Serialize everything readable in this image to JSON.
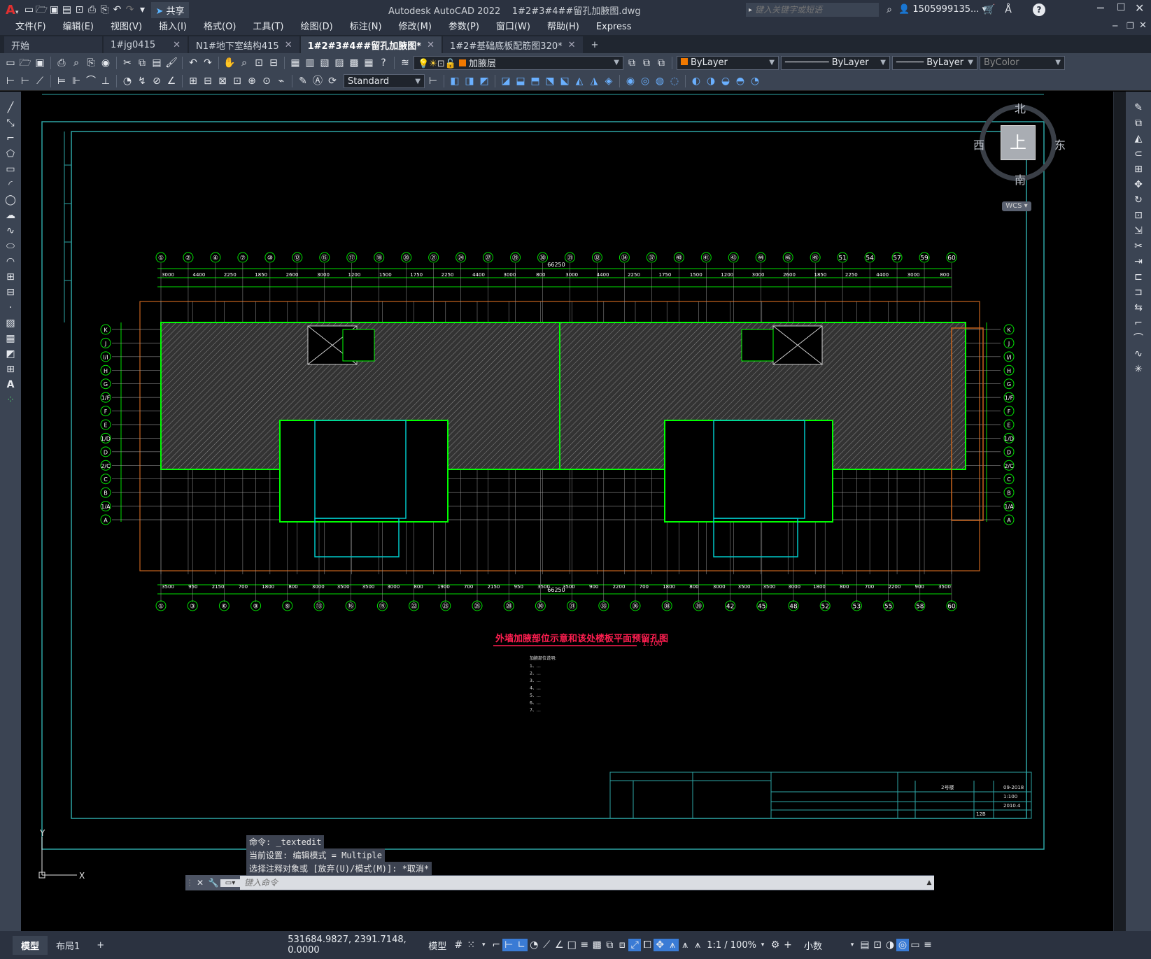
{
  "app": {
    "title": "Autodesk AutoCAD 2022",
    "file": "1#2#3#4##留孔加腋图.dwg",
    "share_label": "共享",
    "search_placeholder": "键入关键字或短语",
    "user": "1505999135...",
    "help": "?"
  },
  "menu": [
    "文件(F)",
    "编辑(E)",
    "视图(V)",
    "插入(I)",
    "格式(O)",
    "工具(T)",
    "绘图(D)",
    "标注(N)",
    "修改(M)",
    "参数(P)",
    "窗口(W)",
    "帮助(H)",
    "Express"
  ],
  "tabs": [
    {
      "label": "开始",
      "close": ""
    },
    {
      "label": "1#jg0415",
      "close": "✕"
    },
    {
      "label": "N1#地下室结构415",
      "close": "✕"
    },
    {
      "label": "1#2#3#4##留孔加腋图*",
      "close": "✕"
    },
    {
      "label": "1#2#基础底板配筋图320*",
      "close": "✕"
    }
  ],
  "new_tab": "+",
  "props": {
    "layer": "加腋层",
    "color": "ByLayer",
    "linetype": "ByLayer",
    "lineweight": "ByLayer",
    "plotstyle": "ByColor",
    "textstyle": "Standard"
  },
  "viewcube": {
    "north": "北",
    "south": "南",
    "east": "东",
    "west": "西",
    "face": "上",
    "wcs": "WCS"
  },
  "drawing": {
    "title": "外墙加腋部位示意和该处楼板平面预留孔图",
    "scale": "1:100",
    "overall_dim": "66250",
    "top_axes": [
      "①",
      "②",
      "④",
      "⑦",
      "⑩",
      "⑫",
      "⑮",
      "⑰",
      "⑱",
      "⑳",
      "㉑",
      "㉔",
      "㉗",
      "㉙",
      "㉚",
      "㉛",
      "㉜",
      "㉞",
      "㊲",
      "㊵",
      "㊶",
      "㊸",
      "㊹",
      "㊻",
      "㊾",
      "51",
      "54",
      "57",
      "59",
      "60"
    ],
    "bottom_axes": [
      "①",
      "③",
      "⑥",
      "⑧",
      "⑨",
      "⑬",
      "⑯",
      "⑲",
      "㉒",
      "㉓",
      "㉕",
      "㉘",
      "㉚",
      "㉛",
      "㉝",
      "㊱",
      "㊳",
      "㊴",
      "42",
      "45",
      "48",
      "52",
      "53",
      "55",
      "58",
      "60"
    ],
    "left_axes": [
      "K",
      "J",
      "I/I",
      "H",
      "G",
      "1/F",
      "F",
      "E",
      "1/D",
      "D",
      "2/C",
      "C",
      "B",
      "1/A",
      "A"
    ],
    "top_dims": [
      "3000",
      "4400",
      "2250",
      "1850",
      "2600",
      "3000",
      "1200",
      "1500",
      "1750",
      "2250",
      "4400",
      "3000",
      "800",
      "3000",
      "4400",
      "2250",
      "1750",
      "1500",
      "1200",
      "3000",
      "2600",
      "1850",
      "2250",
      "4400",
      "3000",
      "800"
    ],
    "bottom_dims": [
      "3500",
      "950",
      "2150",
      "700",
      "1800",
      "800",
      "3000",
      "3500",
      "3500",
      "3000",
      "800",
      "1900",
      "700",
      "2150",
      "950",
      "3500",
      "3500",
      "900",
      "2200",
      "700",
      "1800",
      "800",
      "3000",
      "3500",
      "3500",
      "3000",
      "1800",
      "800",
      "700",
      "2200",
      "900",
      "3500"
    ],
    "notes_header": "加腋部位说明:",
    "notes": [
      "1、…",
      "2、…",
      "3、…",
      "4、…",
      "5、…",
      "6、…",
      "7、…"
    ],
    "titleblock": {
      "project_no": "09-2018",
      "scale": "1:100",
      "date": "2010.4",
      "sheet": "12B",
      "building": "2号楼"
    }
  },
  "command": {
    "lines": [
      "命令: _textedit",
      "当前设置: 编辑模式 = Multiple",
      "选择注释对象或 [放弃(U)/模式(M)]: *取消*"
    ],
    "placeholder": "键入命令"
  },
  "status": {
    "layout_tabs": [
      "模型",
      "布局1"
    ],
    "add_layout": "+",
    "coords": "531684.9827, 2391.7148, 0.0000",
    "space": "模型",
    "scale": "1:1 / 100%",
    "units": "小数"
  },
  "colors": {
    "accent": "#00ff00",
    "cyan": "#00c8c8",
    "orange": "#c8641e",
    "red": "#ff0040",
    "grid": "#9a9a9a"
  }
}
